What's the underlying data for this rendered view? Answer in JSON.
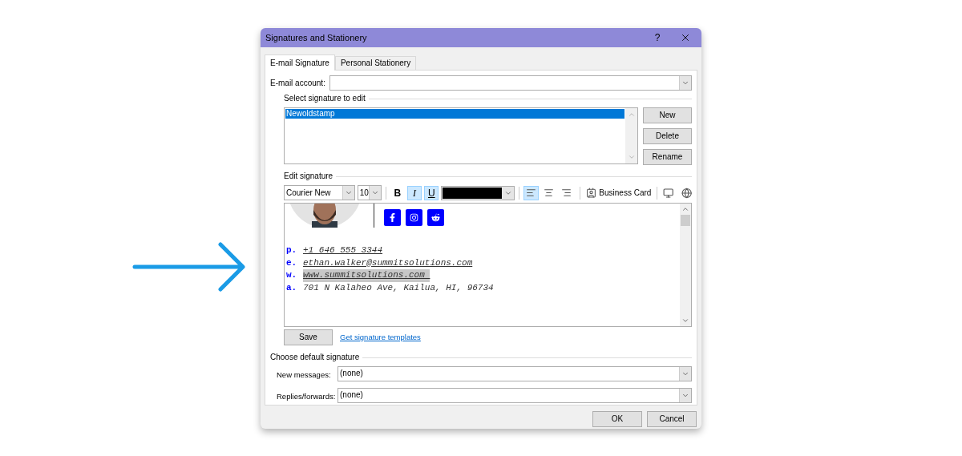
{
  "window": {
    "title": "Signatures and Stationery",
    "help_button": "?"
  },
  "tabs": [
    {
      "label": "E-mail Signature",
      "selected": true
    },
    {
      "label": "Personal Stationery",
      "selected": false
    }
  ],
  "email_account": {
    "label": "E-mail account:"
  },
  "signature_list": {
    "heading": "Select signature to edit",
    "items": [
      {
        "label": "Newoldstamp",
        "selected": true
      }
    ]
  },
  "signature_buttons": [
    "New",
    "Delete",
    "Rename"
  ],
  "edit_signature": {
    "heading": "Edit signature",
    "font": "Courier New",
    "size": "10",
    "format_buttons": [
      {
        "kind": "bold",
        "label": "B",
        "selected": false
      },
      {
        "kind": "italic",
        "label": "I",
        "selected": true
      },
      {
        "kind": "underline",
        "label": "U",
        "selected": true
      }
    ],
    "align_buttons": [
      {
        "kind": "left",
        "selected": true
      },
      {
        "kind": "center",
        "selected": false
      },
      {
        "kind": "right",
        "selected": false
      }
    ],
    "business_card": "Business Card"
  },
  "editor": {
    "social_icons": [
      {
        "kind": "facebook"
      },
      {
        "kind": "instagram"
      },
      {
        "kind": "reddit"
      }
    ],
    "contact_lines": [
      {
        "prefix": "p.",
        "value": "+1 646 555 3344",
        "underlined": true,
        "highlighted": false
      },
      {
        "prefix": "e.",
        "value": "ethan.walker@summitsolutions.com",
        "underlined": true,
        "highlighted": false
      },
      {
        "prefix": "w.",
        "value": "www.summitsolutions.com ",
        "underlined": true,
        "highlighted": true
      },
      {
        "prefix": "a.",
        "value": "701 N Kalaheo Ave, Kailua, HI, 96734",
        "underlined": false,
        "highlighted": false
      }
    ]
  },
  "save_button": "Save",
  "templates_link": "Get signature templates",
  "default_signature": {
    "heading": "Choose default signature",
    "new_messages": {
      "label": "New messages:",
      "value": "(none)"
    },
    "replies_forwards": {
      "label": "Replies/forwards:",
      "value": "(none)"
    }
  },
  "buttons": [
    "OK",
    "Cancel"
  ]
}
